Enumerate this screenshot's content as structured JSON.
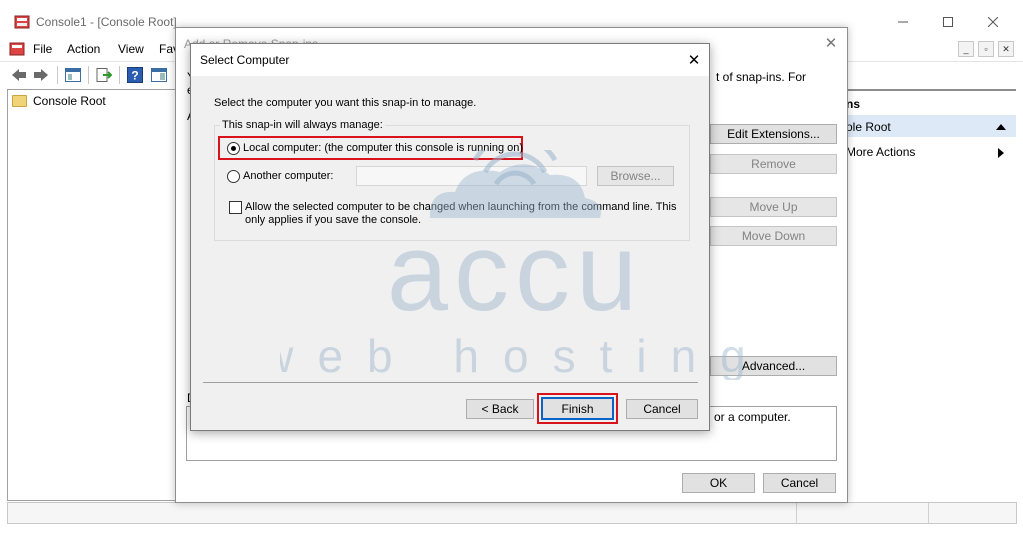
{
  "mmc": {
    "title": "Console1 - [Console Root]",
    "menu": [
      "File",
      "Action",
      "View",
      "Fav"
    ],
    "tree_root": "Console Root",
    "actions_header": "ns",
    "actions_selected": "ole Root",
    "actions_more": "More Actions"
  },
  "snapins": {
    "title": "Add or Remove Snap-ins",
    "left_y": "Y",
    "left_e": "e",
    "left_a": "A",
    "left_d": "D",
    "intro_fragment": "t of snap-ins. For",
    "desc_fragment": "or a computer.",
    "buttons": {
      "edit_extensions": "Edit Extensions...",
      "remove": "Remove",
      "move_up": "Move Up",
      "move_down": "Move Down",
      "advanced": "Advanced...",
      "ok": "OK",
      "cancel": "Cancel"
    }
  },
  "select_computer": {
    "title": "Select Computer",
    "prompt": "Select the computer you want this snap-in to manage.",
    "group_label": "This snap-in will always manage:",
    "local_label": "Local computer:  (the computer this console is running on)",
    "another_label": "Another computer:",
    "another_value": "",
    "browse_label": "Browse...",
    "allow_line1": "Allow the selected computer to be changed when launching from the command line.  This",
    "allow_line2": "only applies if you save the console.",
    "back_label": "< Back",
    "finish_label": "Finish",
    "cancel_label": "Cancel",
    "local_selected": true,
    "allow_checked": false
  },
  "watermark": {
    "brand": "accu",
    "tagline": "web hosting",
    "color": "#9ab4cc"
  },
  "colors": {
    "highlight": "#d8131b",
    "selection": "#dde9f7"
  }
}
